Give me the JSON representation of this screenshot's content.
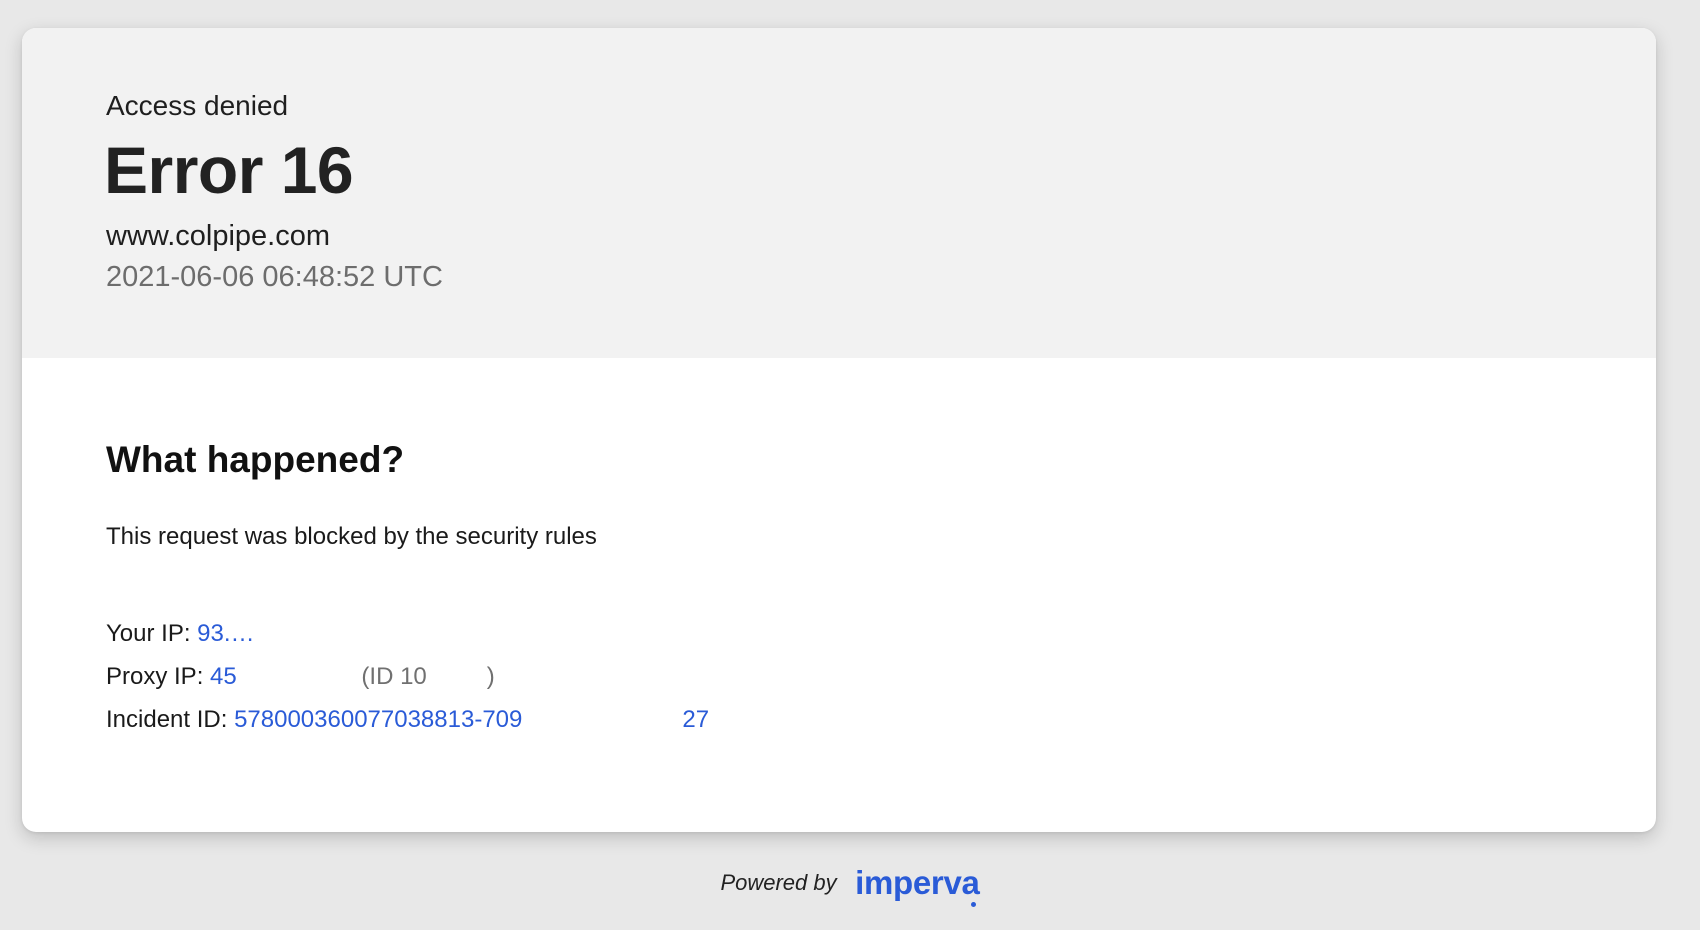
{
  "header": {
    "subtitle": "Access denied",
    "error_title": "Error 16",
    "domain": "www.colpipe.com",
    "timestamp": "2021-06-06 06:48:52 UTC"
  },
  "body": {
    "section_title": "What happened?",
    "message": "This request was blocked by the security rules",
    "your_ip": {
      "label": "Your IP: ",
      "value": "93.…"
    },
    "proxy_ip": {
      "label": "Proxy IP: ",
      "value": "45",
      "tail_prefix": " (ID 10",
      "tail_suffix": ")"
    },
    "incident": {
      "label": "Incident ID: ",
      "value_start": "578000360077038813-709",
      "value_end": "27"
    }
  },
  "footer": {
    "powered_by": "Powered by",
    "brand": "imperva"
  },
  "colors": {
    "link_blue": "#2a5bd7",
    "header_bg": "#f2f2f2",
    "page_bg": "#e8e8e8"
  }
}
